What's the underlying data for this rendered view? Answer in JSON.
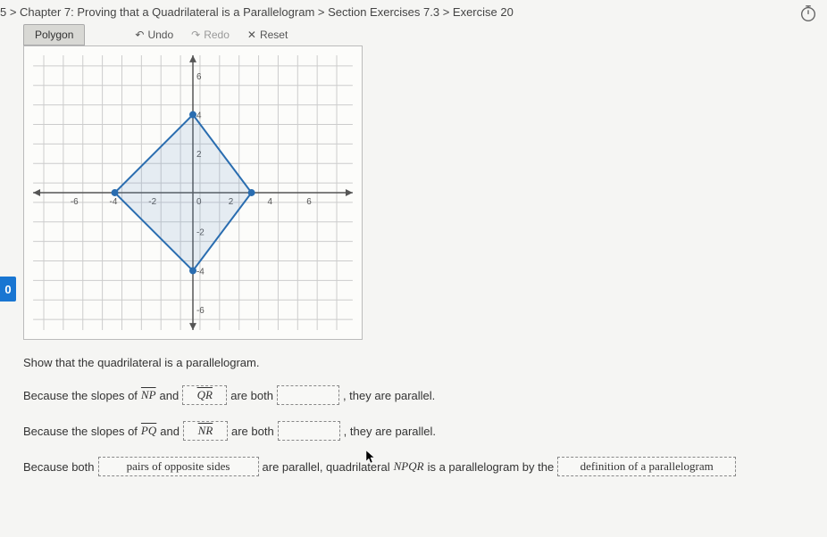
{
  "breadcrumb": "5 > Chapter 7: Proving that a Quadrilateral is a Parallelogram > Section Exercises 7.3 > Exercise 20",
  "toolbar": {
    "tab": "Polygon",
    "undo": "Undo",
    "redo": "Redo",
    "reset": "Reset"
  },
  "side_badge": "0",
  "graph": {
    "x_ticks": [
      "-6",
      "-4",
      "-2",
      "0",
      "2",
      "4",
      "6"
    ],
    "y_ticks": [
      "6",
      "4",
      "2",
      "-2",
      "-4",
      "-6"
    ],
    "vertices": [
      [
        0,
        4
      ],
      [
        3,
        0
      ],
      [
        0,
        -4
      ],
      [
        -4,
        0
      ]
    ]
  },
  "prompt": "Show that the quadrilateral is a parallelogram.",
  "line1": {
    "pre": "Because the slopes of ",
    "seg1": "NP",
    "and": " and ",
    "box1": "QR",
    "mid": " are both ",
    "post": ", they are parallel."
  },
  "line2": {
    "pre": "Because the slopes of ",
    "seg1": "PQ",
    "and": " and ",
    "box1": "NR",
    "mid": " are both ",
    "post": ", they are parallel."
  },
  "line3": {
    "pre": "Because both ",
    "box1": "pairs of opposite sides",
    "mid": " are parallel, quadrilateral ",
    "quad": "NPQR",
    "mid2": " is a parallelogram by the ",
    "box2": "definition of a parallelogram",
    "post": ""
  }
}
